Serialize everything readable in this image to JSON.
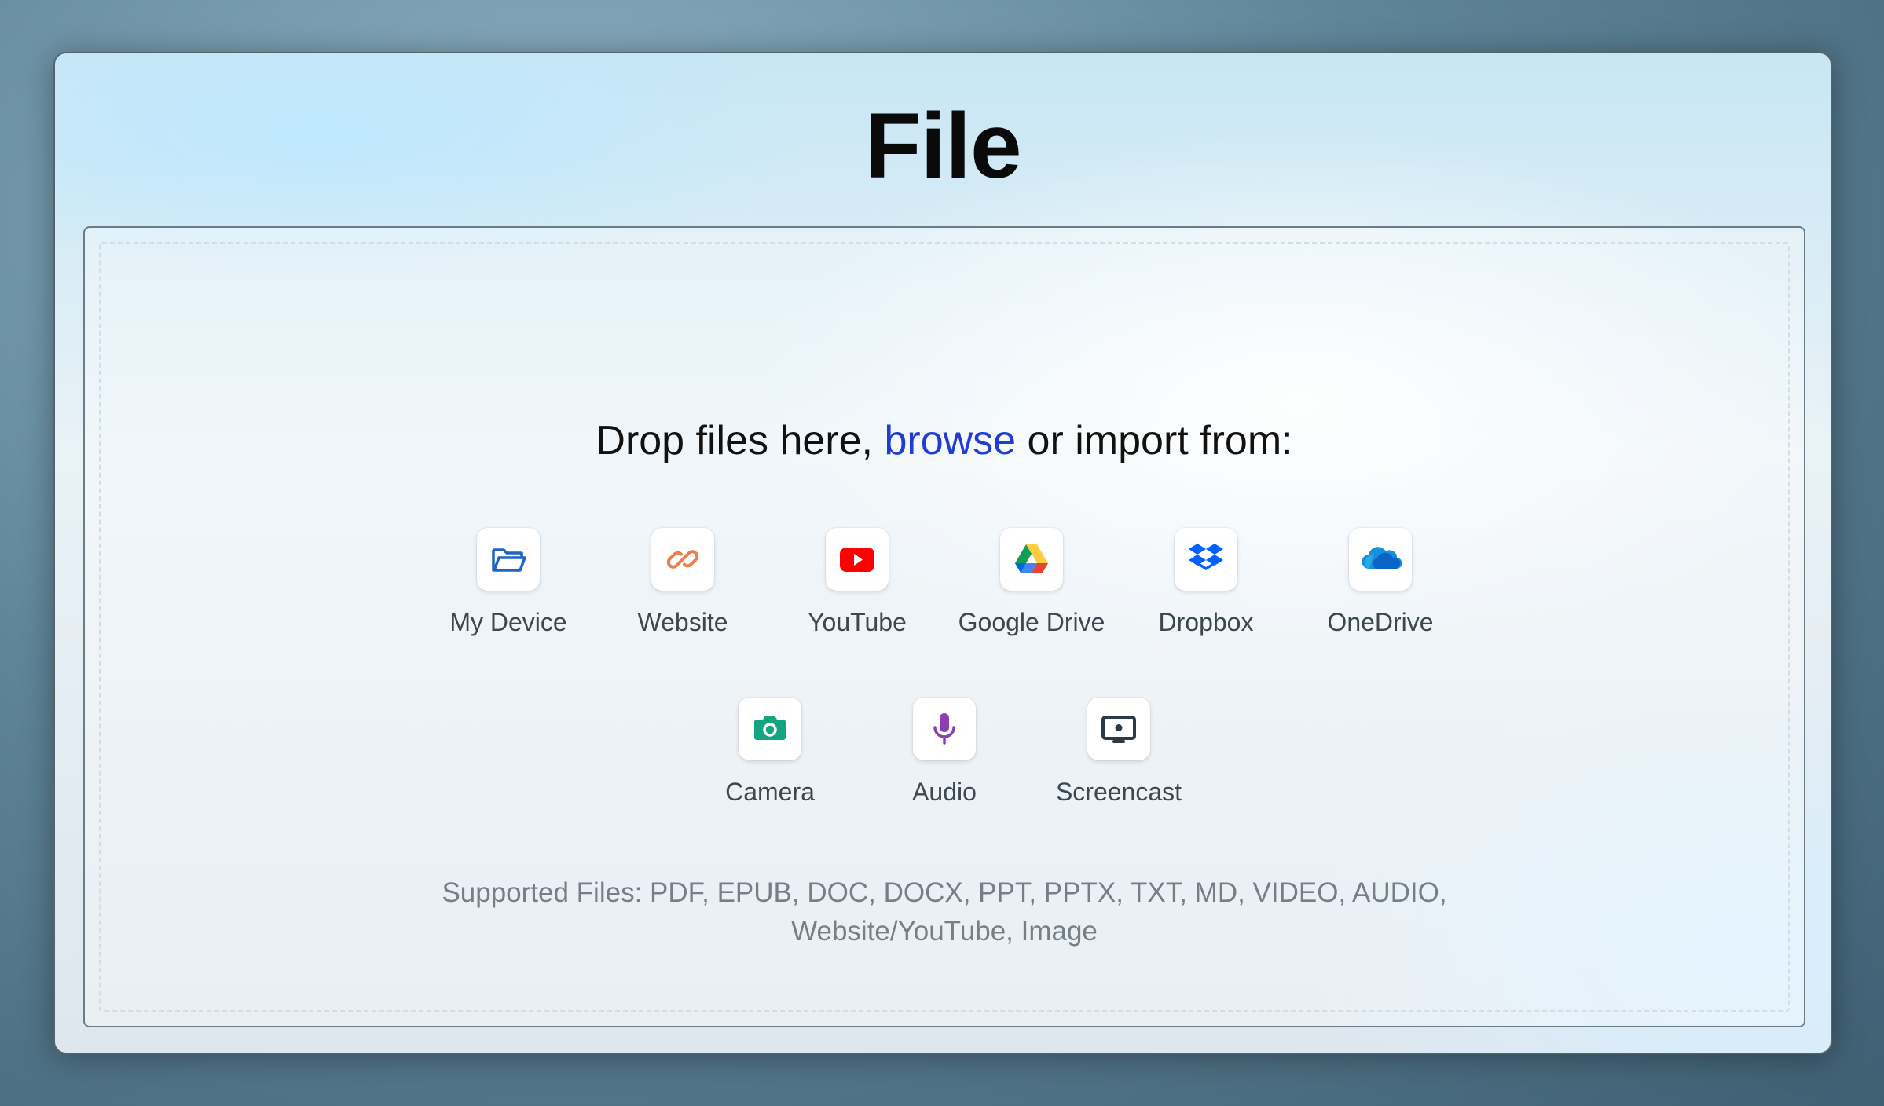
{
  "title": "File",
  "prompt": {
    "before": "Drop files here,",
    "browse": "browse",
    "after": "or import from:"
  },
  "sources": {
    "row1": [
      {
        "label": "My Device",
        "icon": "folder-icon"
      },
      {
        "label": "Website",
        "icon": "link-icon"
      },
      {
        "label": "YouTube",
        "icon": "youtube-icon"
      },
      {
        "label": "Google Drive",
        "icon": "google-drive-icon"
      },
      {
        "label": "Dropbox",
        "icon": "dropbox-icon"
      },
      {
        "label": "OneDrive",
        "icon": "onedrive-icon"
      }
    ],
    "row2": [
      {
        "label": "Camera",
        "icon": "camera-icon"
      },
      {
        "label": "Audio",
        "icon": "microphone-icon"
      },
      {
        "label": "Screencast",
        "icon": "screencast-icon"
      }
    ]
  },
  "supported": {
    "line1": "Supported Files: PDF, EPUB, DOC, DOCX, PPT, PPTX, TXT, MD, VIDEO, AUDIO,",
    "line2": "Website/YouTube, Image"
  },
  "colors": {
    "browse_link": "#1f3cd4",
    "device": "#1f63c4",
    "website": "#ef7e4a",
    "youtube": "#ff0000",
    "dropbox": "#0061fe",
    "onedrive": "#0a64c8",
    "camera": "#12a57f",
    "audio": "#8b3fb3",
    "screencast": "#2b3a45"
  }
}
